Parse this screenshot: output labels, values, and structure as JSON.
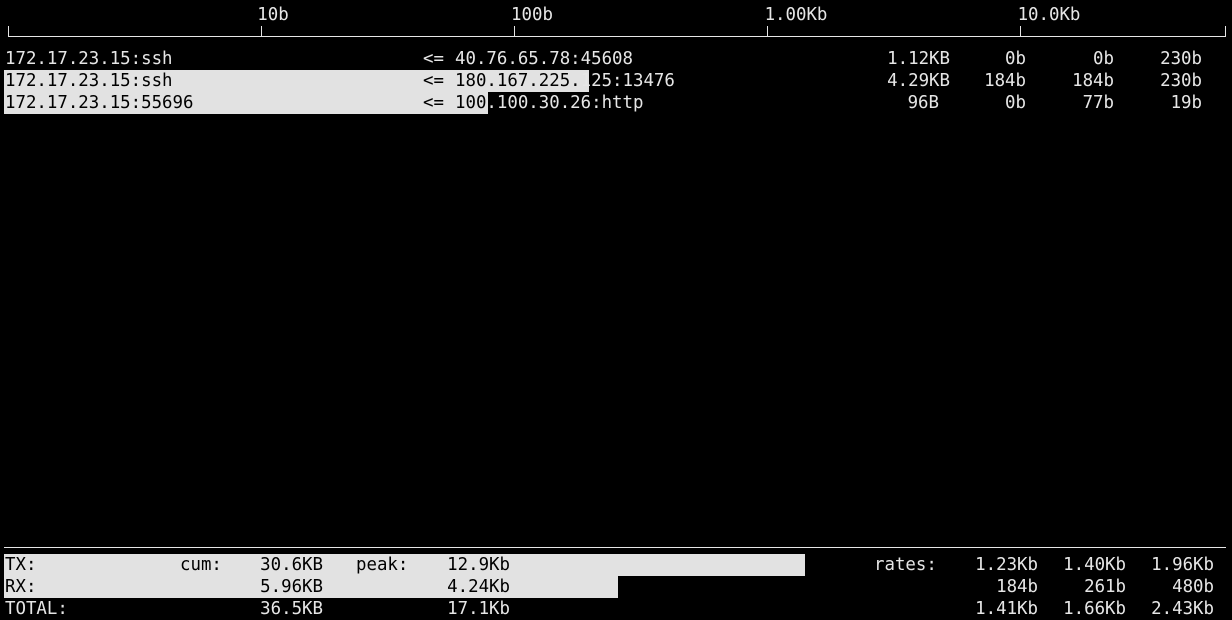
{
  "scale": {
    "ticks": [
      "10b",
      "100b",
      "1.00Kb",
      "10.0Kb"
    ]
  },
  "connections": [
    {
      "local": "172.17.23.15:ssh",
      "direction": "<=",
      "remote": "40.76.65.78:45608",
      "total": "1.12KB",
      "rate_2s": "0b",
      "rate_10s": "0b",
      "rate_40s": "230b",
      "bar_fraction": 0
    },
    {
      "local": "172.17.23.15:ssh",
      "direction": "<=",
      "remote_highlighted": "180.167.225.",
      "remote_rest": "125:13476",
      "total": "4.29KB",
      "rate_2s": "184b",
      "rate_10s": "184b",
      "rate_40s": "230b",
      "bar_fraction": 0.476
    },
    {
      "local": "172.17.23.15:55696",
      "direction": "<=",
      "remote_highlighted": "100",
      "remote_rest": ".100.30.26:http",
      "total": "96B",
      "rate_2s": "0b",
      "rate_10s": "77b",
      "rate_40s": "19b",
      "bar_fraction": 0.394
    }
  ],
  "totals": {
    "tx": {
      "label": "TX:",
      "cum_label": "cum:",
      "cum": "30.6KB",
      "peak_label": "peak:",
      "peak": "12.9Kb",
      "rates_label": "rates:",
      "rate_2s": "1.23Kb",
      "rate_10s": "1.40Kb",
      "rate_40s": "1.96Kb",
      "bar_fraction": 0.652
    },
    "rx": {
      "label": "RX:",
      "cum": "5.96KB",
      "peak": "4.24Kb",
      "rate_2s": "184b",
      "rate_10s": "261b",
      "rate_40s": "480b",
      "bar_fraction": 0.5
    },
    "total": {
      "label": "TOTAL:",
      "cum": "36.5KB",
      "peak": "17.1Kb",
      "rate_2s": "1.41Kb",
      "rate_10s": "1.66Kb",
      "rate_40s": "2.43Kb"
    }
  },
  "colors": {
    "background": "#000000",
    "foreground": "#e6e6e6",
    "bar": "#e2e2e2"
  }
}
